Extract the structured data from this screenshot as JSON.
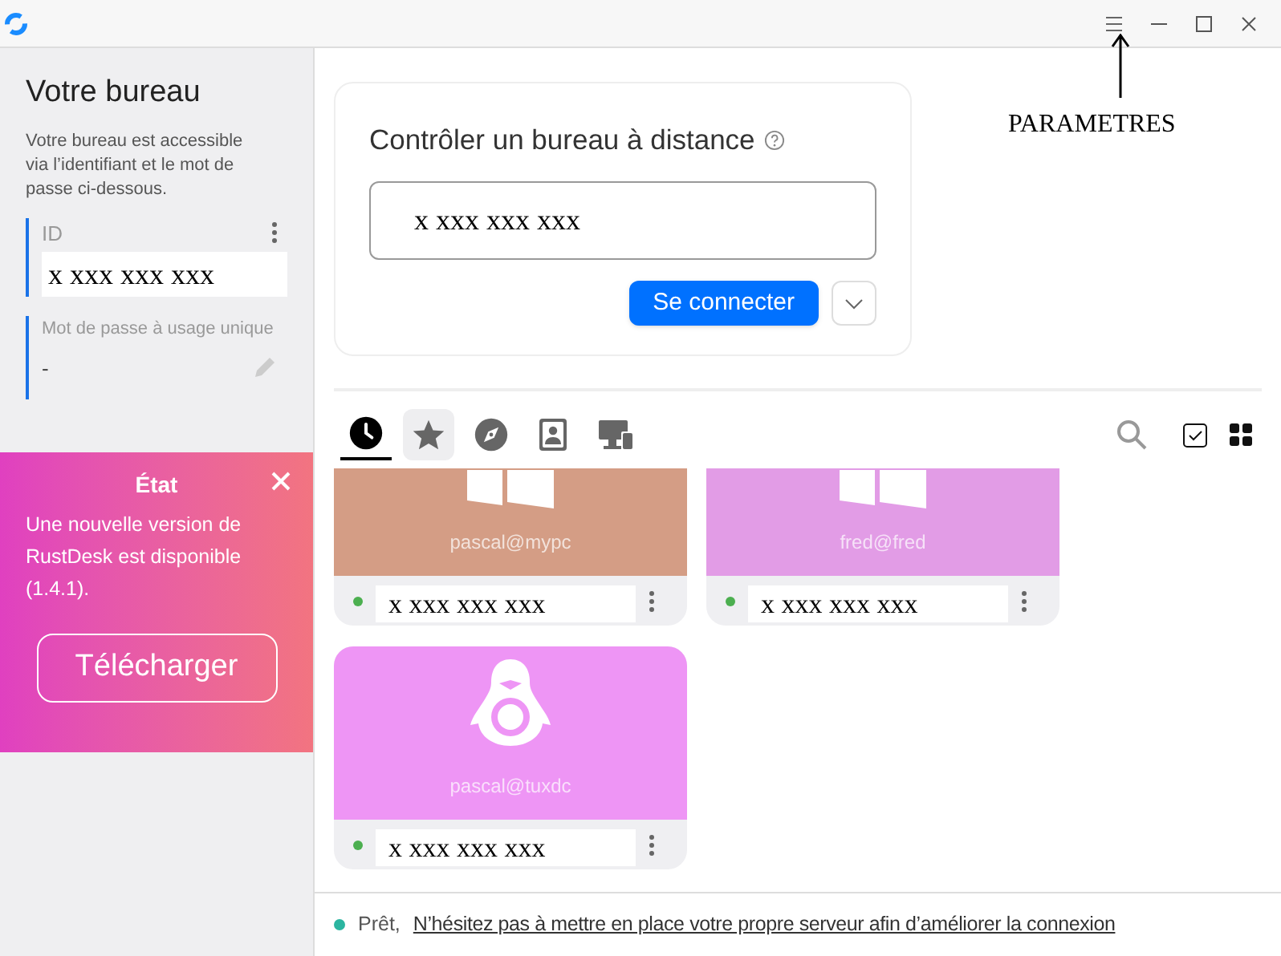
{
  "annotation": {
    "label": "PARAMETRES"
  },
  "sidebar": {
    "title": "Votre bureau",
    "description": "Votre bureau est accessible via l’identifiant et le mot de passe ci-dessous.",
    "id_field": {
      "label": "ID",
      "value": "x xxx xxx xxx"
    },
    "password_field": {
      "label": "Mot de passe à usage unique",
      "value": "-"
    },
    "notification": {
      "title": "État",
      "message": "Une nouvelle version de RustDesk est disponible (1.4.1).",
      "button": "Télécharger"
    }
  },
  "connect_card": {
    "title": "Contrôler un bureau à distance",
    "input_value": "x xxx xxx xxx",
    "button": "Se connecter"
  },
  "tabs": [
    {
      "kind": "recent",
      "selected": true,
      "hovered": false
    },
    {
      "kind": "favorites",
      "selected": false,
      "hovered": true
    },
    {
      "kind": "discovered",
      "selected": false,
      "hovered": false
    },
    {
      "kind": "address-book",
      "selected": false,
      "hovered": false
    },
    {
      "kind": "devices",
      "selected": false,
      "hovered": false
    }
  ],
  "peers": [
    {
      "kind": "windows",
      "color": "#d49d85",
      "name": "pascal@mypc",
      "id": "x xxx xxx xxx",
      "online": true
    },
    {
      "kind": "windows",
      "color": "#e29ce6",
      "name": "fred@fred",
      "id": "x xxx xxx xxx",
      "online": true
    },
    {
      "kind": "linux",
      "color": "#ee95f5",
      "name": "pascal@tuxdc",
      "id": "x xxx xxx xxx",
      "online": true
    }
  ],
  "status_bar": {
    "online": true,
    "status": "Prêt,",
    "link": "N’hésitez pas à mettre en place votre propre serveur afin d’améliorer la connexion"
  }
}
